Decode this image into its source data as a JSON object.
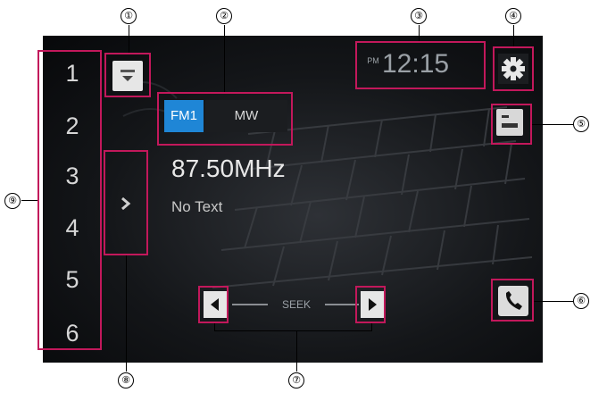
{
  "colors": {
    "highlight": "#c2185b",
    "band_active": "#1f86d6",
    "background": "#141619",
    "text": "#e8e8e8"
  },
  "callouts": [
    "①",
    "②",
    "③",
    "④",
    "⑤",
    "⑥",
    "⑦",
    "⑧",
    "⑨"
  ],
  "presets": [
    "1",
    "2",
    "3",
    "4",
    "5",
    "6"
  ],
  "bands": [
    {
      "label": "FM1",
      "active": true
    },
    {
      "label": "MW",
      "active": false
    }
  ],
  "clock": {
    "ampm": "PM",
    "time": "12:15"
  },
  "frequency": "87.50MHz",
  "station_text": "No Text",
  "seek_label": "SEEK",
  "icons": {
    "source": "source-list-icon",
    "settings": "gear-icon",
    "info": "info-list-icon",
    "phone": "phone-icon",
    "seek_prev": "triangle-left-icon",
    "seek_next": "triangle-right-icon",
    "preset_toggle": "chevron-right-icon"
  }
}
